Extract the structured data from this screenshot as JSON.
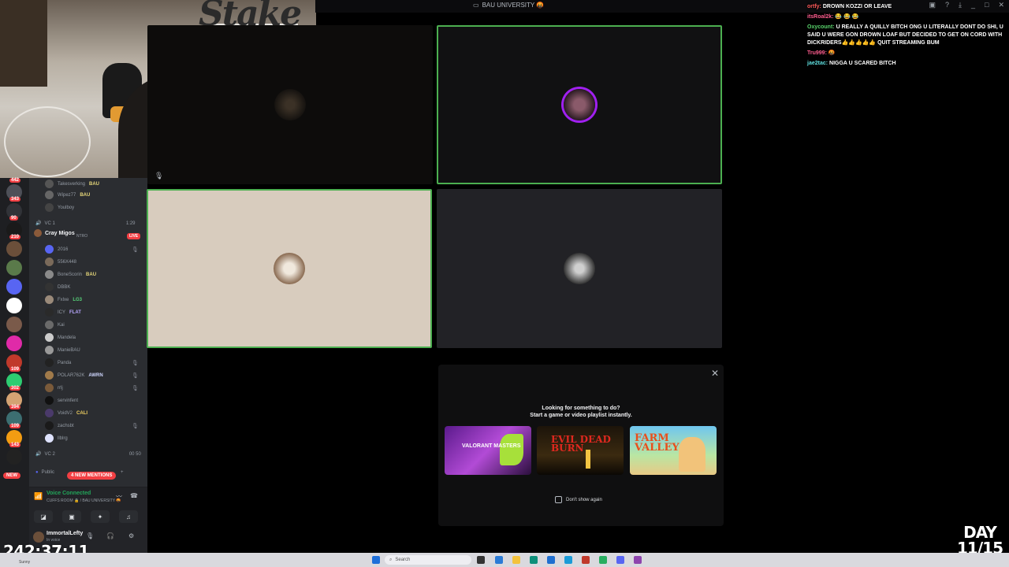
{
  "window": {
    "title": "BAU UNIVERSITY 🤬",
    "controls": [
      "_",
      "□",
      "✕"
    ]
  },
  "webcam": {
    "sign_text": "Stake"
  },
  "servers": {
    "badges": [
      "442",
      "343",
      "90",
      "210",
      "109",
      "302",
      "394",
      "109",
      "143"
    ],
    "new_label": "NEW"
  },
  "channel_list": {
    "members_top": [
      {
        "name": "Takesverking",
        "tag": "BAU"
      },
      {
        "name": "Wipez77",
        "tag": "BAU"
      },
      {
        "name": "Youlboy",
        "tag": ""
      }
    ],
    "vc1": {
      "label": "VC 1",
      "count": "1:29"
    },
    "live_label": "LIVE",
    "streamer": {
      "name": "Cray Migos",
      "subtag": "NTRO"
    },
    "members": [
      {
        "name": "2016",
        "tag": ""
      },
      {
        "name": "556X448",
        "tag": ""
      },
      {
        "name": "BoneScorin",
        "tag": "BAU"
      },
      {
        "name": "DBBK",
        "tag": ""
      },
      {
        "name": "Fxlxe",
        "tag": "LG3"
      },
      {
        "name": "ICY",
        "tag": "FLAT"
      },
      {
        "name": "Kai",
        "tag": ""
      },
      {
        "name": "Mandela",
        "tag": ""
      },
      {
        "name": "ManieBAU",
        "tag": ""
      },
      {
        "name": "Panda",
        "tag": ""
      },
      {
        "name": "POLAR762K",
        "tag": "AWRN"
      },
      {
        "name": "rrlj",
        "tag": ""
      },
      {
        "name": "servinfent",
        "tag": ""
      },
      {
        "name": "VoidV2",
        "tag": "CALI"
      },
      {
        "name": "zachsbt",
        "tag": ""
      },
      {
        "name": "llblrg",
        "tag": ""
      }
    ],
    "vc2": {
      "label": "VC 2",
      "count": "00 50"
    },
    "public_label": "Public",
    "mentions_label": "4 NEW MENTIONS"
  },
  "voice_panel": {
    "title": "Voice Connected",
    "subtitle": "CUFFS ROOM 🔒 / BAU UNIVERSITY 🤬"
  },
  "user_panel": {
    "username": "ImmortalLefty",
    "status": "In voice"
  },
  "popup": {
    "close_label": "✕",
    "heading": "Looking for something to do?",
    "subheading": "Start a game or video playlist instantly.",
    "cards": [
      {
        "title": "VALORANT MASTERS"
      },
      {
        "title": "EVIL DEAD BURN"
      },
      {
        "title": "FARM VALLEY"
      }
    ],
    "checkbox_label": "Don't show again"
  },
  "chat": [
    {
      "user": "ortfy:",
      "message": "DROWN KOZZI OR LEAVE"
    },
    {
      "user": "itsRoal2k:",
      "message": "😂 😂 😂"
    },
    {
      "user": "Oxycount:",
      "message": "U REALLY A QUILLY BITCH ONG U LITERALLY DONT DO SHI, U SAID U WERE GON DROWN LOAF BUT DECIDED TO GET ON CORD WITH DICKRIDERS👍👍👍👍👍 QUIT STREAMING BUM"
    },
    {
      "user": "Tru999:",
      "message": "🤬"
    },
    {
      "user": "jae2tac:",
      "message": "NIGGA U SCARED BITCH"
    }
  ],
  "stream_timer": "242:37:11",
  "day_counter": {
    "line1": "DAY",
    "line2": "11/15"
  },
  "taskbar": {
    "search_placeholder": "Search",
    "left_label": "Sunny"
  }
}
